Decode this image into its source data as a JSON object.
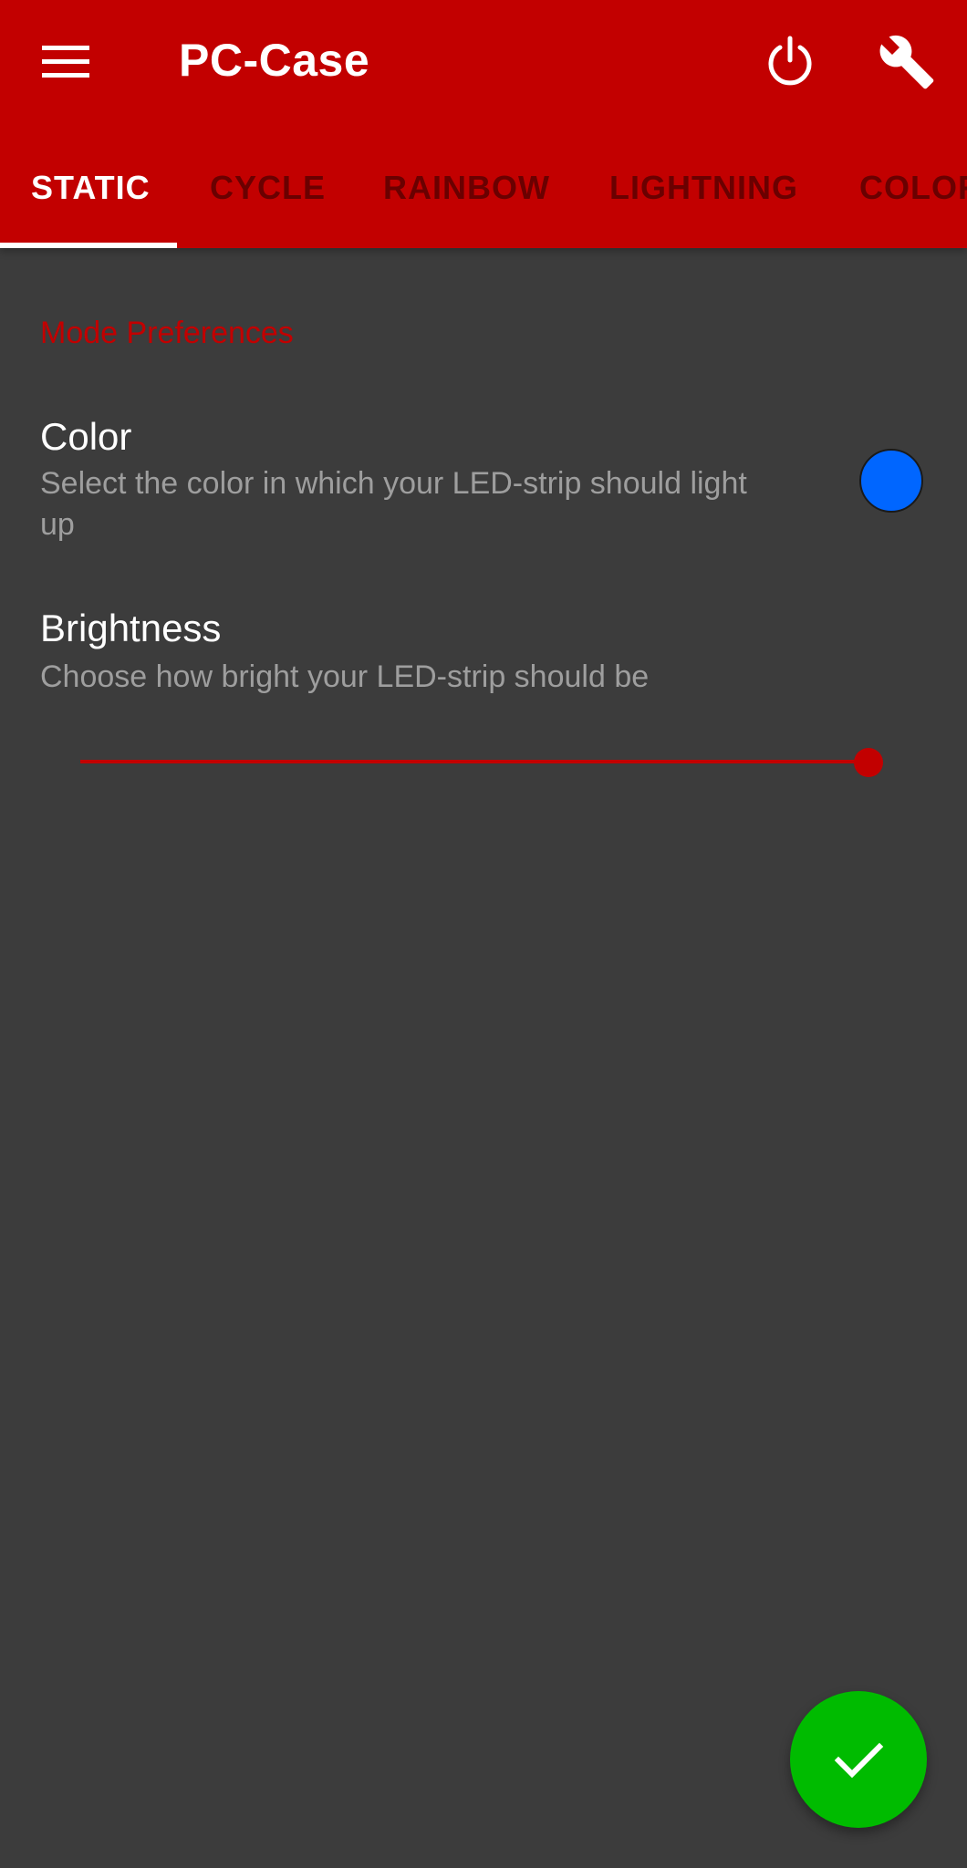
{
  "app": {
    "title": "PC-Case",
    "primary_color": "#c20000",
    "background_color": "#3c3c3c"
  },
  "toolbar": {
    "menu_icon": "hamburger-menu-icon",
    "actions": [
      {
        "icon": "power-icon"
      },
      {
        "icon": "wrench-icon"
      }
    ]
  },
  "tabs": {
    "selected": "STATIC",
    "items": [
      {
        "label": "STATIC"
      },
      {
        "label": "CYCLE"
      },
      {
        "label": "RAINBOW"
      },
      {
        "label": "LIGHTNING"
      },
      {
        "label": "COLOR"
      }
    ]
  },
  "preferences": {
    "section_title": "Mode Preferences",
    "color": {
      "title": "Color",
      "summary": "Select the color in which your LED-strip should light up",
      "value": "#0066ff"
    },
    "brightness": {
      "title": "Brightness",
      "summary": "Choose how bright your LED-strip should be",
      "level": 1.0,
      "accent": "#c20000"
    }
  },
  "fab": {
    "icon": "checkmark-icon",
    "color": "#00bb00"
  }
}
